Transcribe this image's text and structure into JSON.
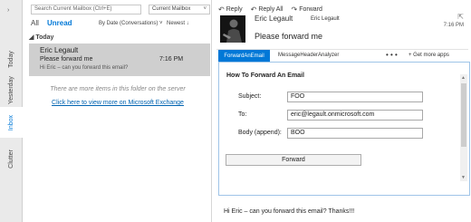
{
  "nav": {
    "items": [
      {
        "label": "Today",
        "active": false
      },
      {
        "label": "Yesterday",
        "active": false
      },
      {
        "label": "Inbox",
        "active": true
      },
      {
        "label": "Clutter",
        "active": false
      }
    ]
  },
  "list": {
    "search_placeholder": "Search Current Mailbox (Ctrl+E)",
    "scope": "Current Mailbox",
    "filter_all": "All",
    "filter_unread": "Unread",
    "sort": "By Date (Conversations) ˅",
    "order": "Newest ↓",
    "group_header": "Today",
    "items": [
      {
        "sender": "Eric Legault",
        "subject": "Please forward me",
        "time": "7:16 PM",
        "preview": "Hi Eric – can you forward this email?"
      }
    ],
    "more_note": "There are more items in this folder on the server",
    "more_link": "Click here to view more on Microsoft Exchange"
  },
  "reader": {
    "actions": {
      "reply": "Reply",
      "reply_all": "Reply All",
      "forward": "Forward"
    },
    "from": "Eric Legault",
    "to": "Eric Legault",
    "time": "7:16 PM",
    "subject": "Please forward me",
    "tabs": {
      "active": "ForwardAnEmail",
      "second": "MessageHeaderAnalyzer",
      "more": "• • •",
      "get_more": "+ Get more apps"
    },
    "addin": {
      "title": "How To Forward An Email",
      "subject_label": "Subject:",
      "subject_value": "FOO",
      "to_label": "To:",
      "to_value": "eric@legault.onmicrosoft.com",
      "body_label": "Body (append):",
      "body_value": "BOO",
      "button": "Forward"
    },
    "body": "Hi Eric – can you forward this email? Thanks!!!"
  },
  "colors": {
    "accent": "#0078d7",
    "selected_row": "#cfcfcf"
  }
}
